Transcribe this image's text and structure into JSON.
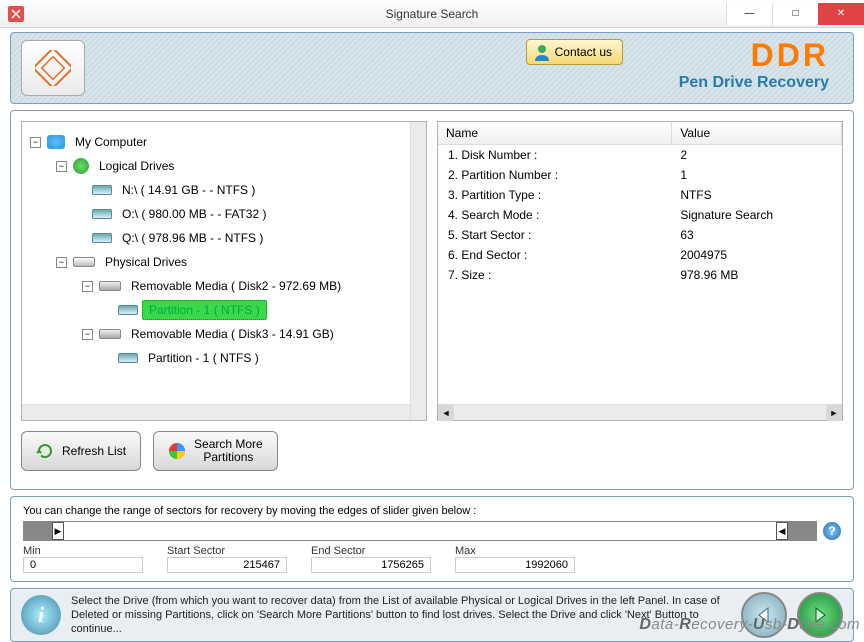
{
  "window": {
    "title": "Signature Search",
    "min": "—",
    "max": "□",
    "close": "✕"
  },
  "header": {
    "contact": "Contact us",
    "brand": "DDR",
    "subtitle": "Pen Drive Recovery"
  },
  "tree": {
    "root": "My Computer",
    "logical": "Logical Drives",
    "n": "N:\\ ( 14.91 GB -  - NTFS )",
    "o": "O:\\ ( 980.00 MB -  - FAT32 )",
    "q": "Q:\\ ( 978.96 MB -  - NTFS )",
    "physical": "Physical Drives",
    "rm2": "Removable Media ( Disk2 - 972.69 MB)",
    "part1": "Partition - 1 ( NTFS )",
    "rm3": "Removable Media ( Disk3 - 14.91 GB)",
    "part2": "Partition - 1 ( NTFS )"
  },
  "table": {
    "headers": {
      "name": "Name",
      "value": "Value"
    },
    "rows": [
      {
        "name": "1. Disk Number :",
        "value": "2"
      },
      {
        "name": "2. Partition Number :",
        "value": "1"
      },
      {
        "name": "3. Partition Type :",
        "value": "NTFS"
      },
      {
        "name": "4. Search Mode :",
        "value": "Signature Search"
      },
      {
        "name": "5. Start Sector :",
        "value": "63"
      },
      {
        "name": "6. End Sector :",
        "value": "2004975"
      },
      {
        "name": "7. Size :",
        "value": "978.96 MB"
      }
    ]
  },
  "buttons": {
    "refresh": "Refresh List",
    "searchMore": "Search More\nPartitions"
  },
  "slider": {
    "instruction": "You can change the range of sectors for recovery by moving the edges of slider given below :",
    "min_label": "Min",
    "min_value": "0",
    "start_label": "Start Sector",
    "start_value": "215467",
    "end_label": "End Sector",
    "end_value": "1756265",
    "max_label": "Max",
    "max_value": "1992060"
  },
  "footer": {
    "text": "Select the Drive (from which you want to recover data) from the List of available Physical or Logical Drives in the left Panel. In case of Deleted or missing Partitions, click on 'Search More Partitions' button to find lost drives. Select the Drive and click 'Next' Button to continue..."
  },
  "watermark": "Data-Recovery-Usb-Drive.com"
}
